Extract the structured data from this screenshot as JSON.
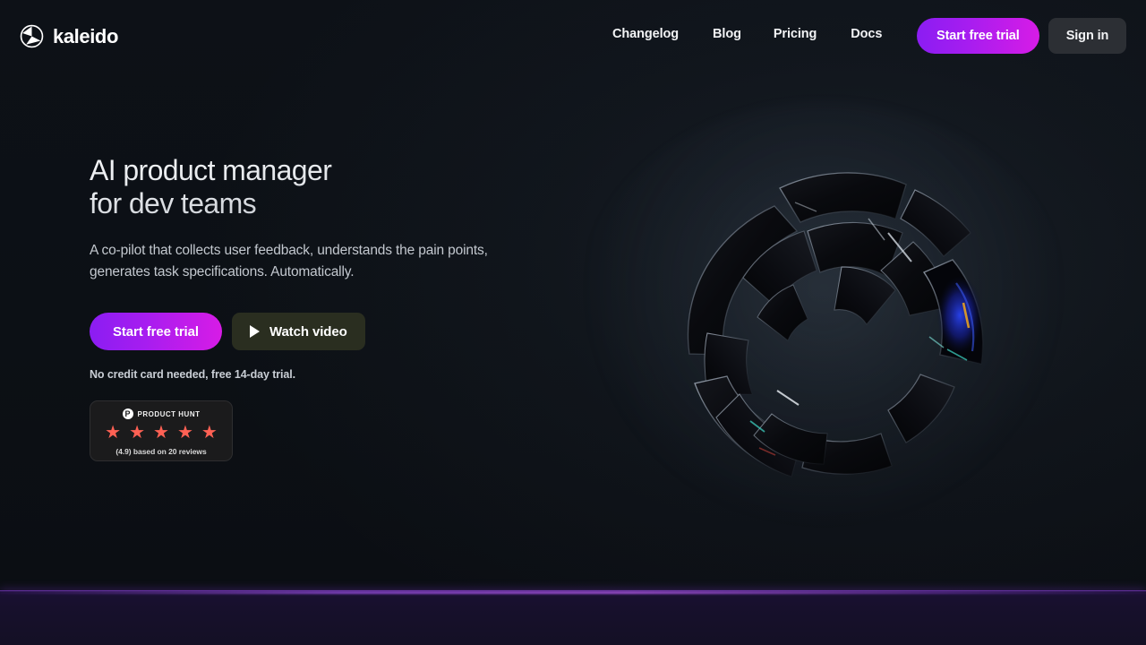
{
  "brand": {
    "name": "kaleido",
    "logo_icon": "kaleido-circle-mark"
  },
  "nav": {
    "links": [
      {
        "label": "Changelog"
      },
      {
        "label": "Blog"
      },
      {
        "label": "Pricing"
      },
      {
        "label": "Docs"
      }
    ],
    "trial_button": "Start free trial",
    "signin_button": "Sign in"
  },
  "hero": {
    "title_line1": "AI product manager",
    "title_line2": "for dev teams",
    "subtitle": "A co-pilot that collects user feedback, understands the pain points, generates task specifications. Automatically.",
    "primary_cta": "Start free trial",
    "secondary_cta": "Watch video",
    "secondary_cta_icon": "play-icon",
    "note": "No credit card needed, free 14-day trial.",
    "art_alt": "abstract-3d-sphere"
  },
  "product_hunt": {
    "label": "PRODUCT HUNT",
    "logo_letter": "P",
    "stars": [
      "★",
      "★",
      "★",
      "★",
      "★"
    ],
    "rating_text": "(4.9) based on 20 reviews"
  },
  "colors": {
    "background": "#0d1117",
    "accent_gradient_start": "#8b1df2",
    "accent_gradient_end": "#d71ce6",
    "signin_bg": "#2c2f34",
    "watch_bg": "#2a2e20",
    "star": "#ff6154",
    "next_section_bg": "#17102c",
    "divider_glow": "#a855f7"
  }
}
